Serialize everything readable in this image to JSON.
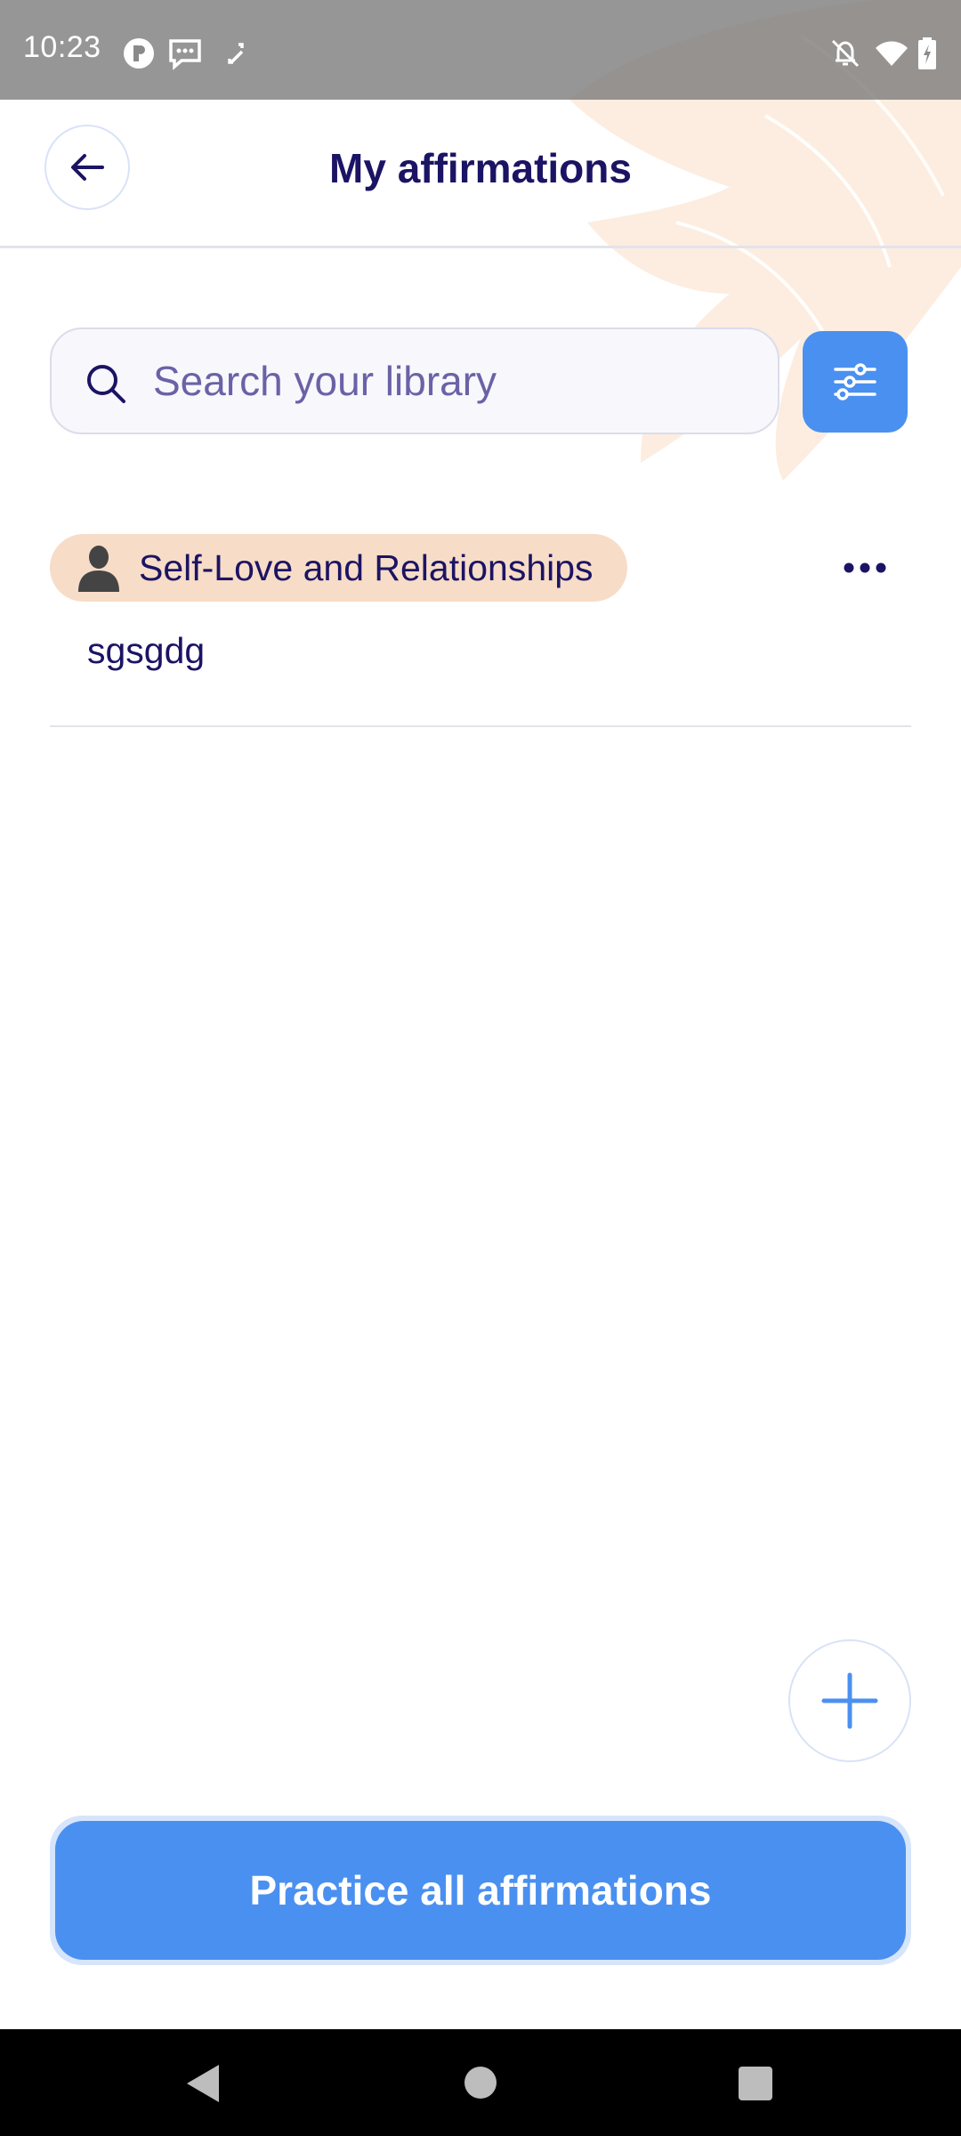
{
  "status_bar": {
    "time": "10:23",
    "icons": [
      "app-notification-icon",
      "chat-icon",
      "sync-icon",
      "bell-off-icon",
      "wifi-icon",
      "battery-charging-icon"
    ]
  },
  "header": {
    "title": "My affirmations",
    "back_icon": "arrow-left-icon"
  },
  "search": {
    "placeholder": "Search your library",
    "value": "",
    "icon": "search-icon",
    "filter_icon": "sliders-icon"
  },
  "library": {
    "items": [
      {
        "category": "Self-Love and Relationships",
        "category_icon": "person-icon",
        "text": "sgsgdg",
        "menu_icon": "more-horizontal-icon"
      }
    ]
  },
  "actions": {
    "add_icon": "plus-icon",
    "practice_label": "Practice all affirmations"
  },
  "colors": {
    "primary": "#4A90F0",
    "title_text": "#1B1464",
    "chip_background": "#F7DCC7",
    "decor": "#FCEBDD"
  },
  "nav_bar": {
    "buttons": [
      "nav-back-icon",
      "nav-home-icon",
      "nav-recents-icon"
    ]
  }
}
